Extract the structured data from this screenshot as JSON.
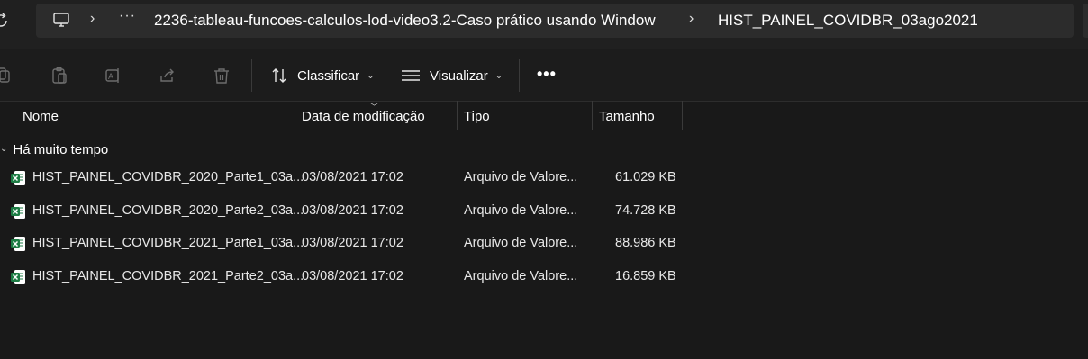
{
  "address": {
    "crumbs": [
      "2236-tableau-funcoes-calculos-lod-video3.2-Caso prático usando Window",
      "HIST_PAINEL_COVIDBR_03ago2021"
    ],
    "sep1": "›",
    "sep2": "›",
    "sep3": "›",
    "more": "···"
  },
  "toolbar": {
    "sort_label": "Classificar",
    "view_label": "Visualizar",
    "more": "•••"
  },
  "columns": {
    "name": "Nome",
    "date": "Data de modificação",
    "type": "Tipo",
    "size": "Tamanho"
  },
  "group": {
    "label": "Há muito tempo",
    "chevron": "⌄"
  },
  "files": [
    {
      "name": "HIST_PAINEL_COVIDBR_2020_Parte1_03a...",
      "date": "03/08/2021 17:02",
      "type": "Arquivo de Valore...",
      "size": "61.029 KB"
    },
    {
      "name": "HIST_PAINEL_COVIDBR_2020_Parte2_03a...",
      "date": "03/08/2021 17:02",
      "type": "Arquivo de Valore...",
      "size": "74.728 KB"
    },
    {
      "name": "HIST_PAINEL_COVIDBR_2021_Parte1_03a...",
      "date": "03/08/2021 17:02",
      "type": "Arquivo de Valore...",
      "size": "88.986 KB"
    },
    {
      "name": "HIST_PAINEL_COVIDBR_2021_Parte2_03a...",
      "date": "03/08/2021 17:02",
      "type": "Arquivo de Valore...",
      "size": "16.859 KB"
    }
  ],
  "colors": {
    "background": "#191919",
    "excel_green": "#1d7c44"
  },
  "icons": {
    "file": "excel-csv-icon",
    "pc": "this-pc-icon"
  }
}
